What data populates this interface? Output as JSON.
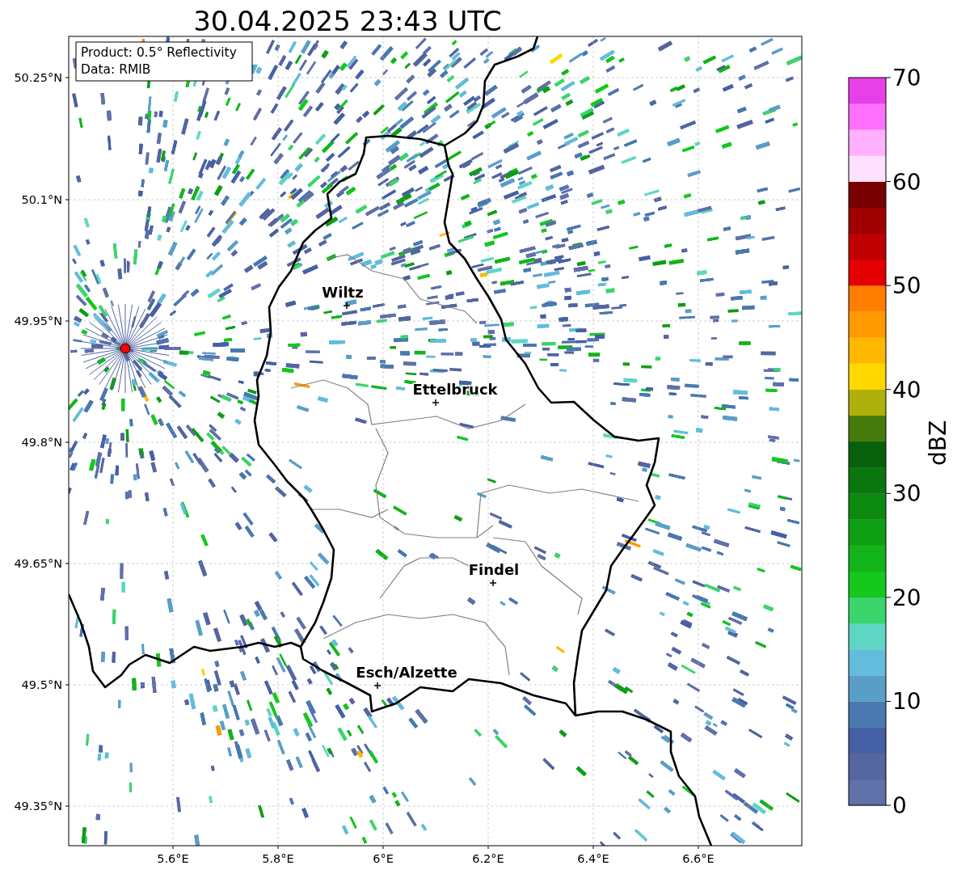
{
  "title": "30.04.2025 23:43 UTC",
  "info_box": [
    "Product: 0.5° Reflectivity",
    "Data: RMIB"
  ],
  "map": {
    "lat_ticks": [
      "50.25°N",
      "50.1°N",
      "49.95°N",
      "49.8°N",
      "49.65°N",
      "49.5°N",
      "49.35°N"
    ],
    "lon_ticks": [
      "5.6°E",
      "5.8°E",
      "6°E",
      "6.2°E",
      "6.4°E",
      "6.6°E"
    ],
    "cities": [
      {
        "name": "Wiltz"
      },
      {
        "name": "Ettelbruck"
      },
      {
        "name": "Findel"
      },
      {
        "name": "Esch/Alzette"
      }
    ]
  },
  "colorbar": {
    "label": "dBZ",
    "ticks": [
      "70",
      "60",
      "50",
      "40",
      "30",
      "20",
      "10",
      "0"
    ],
    "bins": [
      {
        "color": "#6070a8"
      },
      {
        "color": "#5465a0"
      },
      {
        "color": "#4660a5"
      },
      {
        "color": "#4a78b0"
      },
      {
        "color": "#5a9ec8"
      },
      {
        "color": "#62bcdc"
      },
      {
        "color": "#5fd6c4"
      },
      {
        "color": "#3cd46c"
      },
      {
        "color": "#14c81e"
      },
      {
        "color": "#12b41a"
      },
      {
        "color": "#0e9e14"
      },
      {
        "color": "#0c8a10"
      },
      {
        "color": "#0a760e"
      },
      {
        "color": "#08600c"
      },
      {
        "color": "#467a0c"
      },
      {
        "color": "#b0b00a"
      },
      {
        "color": "#ffd800"
      },
      {
        "color": "#ffb800"
      },
      {
        "color": "#ff9a00"
      },
      {
        "color": "#ff7e00"
      },
      {
        "color": "#e40000"
      },
      {
        "color": "#c00000"
      },
      {
        "color": "#a00000"
      },
      {
        "color": "#780000"
      },
      {
        "color": "#ffe0ff"
      },
      {
        "color": "#ffb0ff"
      },
      {
        "color": "#ff70ff"
      },
      {
        "color": "#e840e8"
      }
    ]
  }
}
